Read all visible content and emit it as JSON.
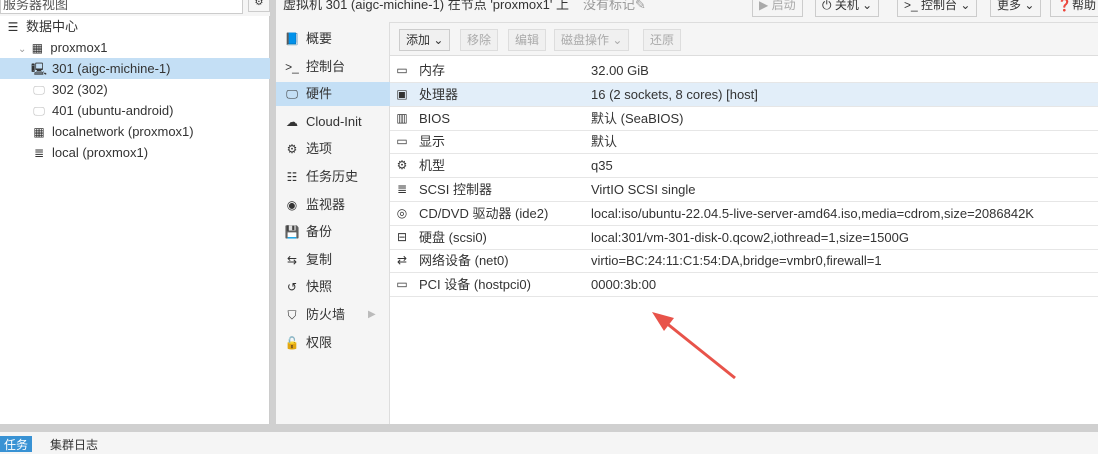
{
  "search": {
    "placeholder": "服务器视图"
  },
  "tree": [
    {
      "label": "数据中心",
      "icon": "datacenter-icon"
    },
    {
      "label": "proxmox1",
      "icon": "node-online-icon"
    },
    {
      "label": "301 (aigc-michine-1)",
      "icon": "vm-running-icon",
      "selected": true
    },
    {
      "label": "302 (302)",
      "icon": "vm-stopped-icon"
    },
    {
      "label": "401 (ubuntu-android)",
      "icon": "vm-stopped-icon"
    },
    {
      "label": "localnetwork (proxmox1)",
      "icon": "network-grid-icon"
    },
    {
      "label": "local (proxmox1)",
      "icon": "storage-icon"
    }
  ],
  "header": {
    "title": "虚拟机 301 (aigc-michine-1) 在节点 'proxmox1' 上",
    "tags": "没有标记✎",
    "buttons": {
      "start": "▶ 启动",
      "shutdown": "⏻ 关机",
      "console": ">_ 控制台",
      "more": "更多",
      "help": "帮助"
    }
  },
  "submenu": [
    {
      "label": "概要",
      "icon": "book-icon"
    },
    {
      "label": "控制台",
      "icon": "terminal-icon"
    },
    {
      "label": "硬件",
      "icon": "monitor-icon",
      "selected": true
    },
    {
      "label": "Cloud-Init",
      "icon": "cloud-icon"
    },
    {
      "label": "选项",
      "icon": "gear-icon"
    },
    {
      "label": "任务历史",
      "icon": "list-icon"
    },
    {
      "label": "监视器",
      "icon": "eye-icon"
    },
    {
      "label": "备份",
      "icon": "floppy-icon"
    },
    {
      "label": "复制",
      "icon": "retweet-icon"
    },
    {
      "label": "快照",
      "icon": "history-icon"
    },
    {
      "label": "防火墙",
      "icon": "shield-icon"
    },
    {
      "label": "权限",
      "icon": "unlock-icon"
    }
  ],
  "toolbar": {
    "add": "添加",
    "remove": "移除",
    "edit": "编辑",
    "disk_action": "磁盘操作",
    "revert": "还原"
  },
  "hardware": [
    {
      "key": "内存",
      "value": "32.00 GiB",
      "icon": "memory-icon"
    },
    {
      "key": "处理器",
      "value": "16 (2 sockets, 8 cores) [host]",
      "icon": "cpu-icon",
      "selected": true
    },
    {
      "key": "BIOS",
      "value": "默认 (SeaBIOS)",
      "icon": "chip-icon"
    },
    {
      "key": "显示",
      "value": "默认",
      "icon": "display-icon"
    },
    {
      "key": "机型",
      "value": "q35",
      "icon": "cogs-icon"
    },
    {
      "key": "SCSI 控制器",
      "value": "VirtIO SCSI single",
      "icon": "database-icon"
    },
    {
      "key": "CD/DVD 驱动器 (ide2)",
      "value": "local:iso/ubuntu-22.04.5-live-server-amd64.iso,media=cdrom,size=2086842K",
      "icon": "cdrom-icon"
    },
    {
      "key": "硬盘 (scsi0)",
      "value": "local:301/vm-301-disk-0.qcow2,iothread=1,size=1500G",
      "icon": "hdd-icon"
    },
    {
      "key": "网络设备 (net0)",
      "value": "virtio=BC:24:11:C1:54:DA,bridge=vmbr0,firewall=1",
      "icon": "exchange-icon"
    },
    {
      "key": "PCI 设备 (hostpci0)",
      "value": "0000:3b:00",
      "icon": "pci-card-icon"
    }
  ],
  "bottom": {
    "tasks": "任务",
    "cluster_log": "集群日志"
  },
  "colors": {
    "selection": "#c4dff5",
    "accent": "#3892d4",
    "arrow": "#e8534a"
  }
}
